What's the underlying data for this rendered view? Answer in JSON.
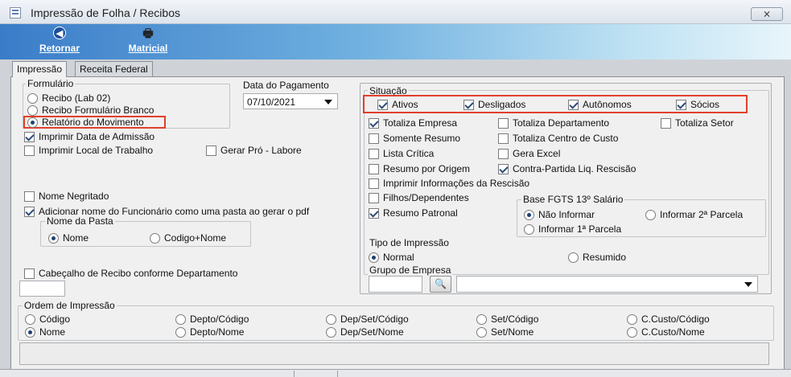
{
  "window": {
    "title": "Impressão de Folha / Recibos",
    "close_label": "⨯"
  },
  "toolbar": {
    "retornar": {
      "label": "Retornar",
      "icon": "back-arrow-icon"
    },
    "matricial": {
      "label": "Matricial",
      "icon": "printer-icon"
    }
  },
  "tabs": [
    {
      "label": "Impressão",
      "active": true
    },
    {
      "label": "Receita Federal",
      "active": false
    }
  ],
  "formulario": {
    "legend": "Formulário",
    "options": [
      {
        "label": "Recibo (Lab 02)",
        "selected": false
      },
      {
        "label": "Recibo Formulário Branco",
        "selected": false
      },
      {
        "label": "Relatório do Movimento",
        "selected": true
      }
    ]
  },
  "data_pagamento": {
    "label": "Data do Pagamento",
    "value": "07/10/2021"
  },
  "left_checks": {
    "imprimir_data_admissao": {
      "label": "Imprimir Data de Admissão",
      "checked": true
    },
    "imprimir_local_trabalho": {
      "label": "Imprimir Local de Trabalho",
      "checked": false
    },
    "gerar_pro_labore": {
      "label": "Gerar Pró - Labore",
      "checked": false
    },
    "nome_negritado": {
      "label": "Nome Negritado",
      "checked": false
    },
    "adicionar_nome": {
      "label": "Adicionar nome do Funcionário como uma pasta ao gerar o pdf",
      "checked": true
    },
    "cabecalho": {
      "label": "Cabeçalho de Recibo conforme Departamento",
      "checked": false
    }
  },
  "nome_pasta": {
    "legend": "Nome da Pasta",
    "options": [
      {
        "label": "Nome",
        "selected": true
      },
      {
        "label": "Codigo+Nome",
        "selected": false
      }
    ]
  },
  "situacao": {
    "legend": "Situação",
    "items": [
      {
        "label": "Ativos",
        "checked": true
      },
      {
        "label": "Desligados",
        "checked": true
      },
      {
        "label": "Autônomos",
        "checked": true
      },
      {
        "label": "Sócios",
        "checked": true
      }
    ]
  },
  "right_checks": {
    "totaliza_empresa": {
      "label": "Totaliza Empresa",
      "checked": true
    },
    "totaliza_departamento": {
      "label": "Totaliza Departamento",
      "checked": false
    },
    "totaliza_setor": {
      "label": "Totaliza Setor",
      "checked": false
    },
    "somente_resumo": {
      "label": "Somente Resumo",
      "checked": false
    },
    "totaliza_centro_custo": {
      "label": "Totaliza Centro de Custo",
      "checked": false
    },
    "lista_critica": {
      "label": "Lista Crítica",
      "checked": false
    },
    "gera_excel": {
      "label": "Gera Excel",
      "checked": false
    },
    "resumo_origem": {
      "label": "Resumo por Origem",
      "checked": false
    },
    "contra_partida": {
      "label": "Contra-Partida Liq. Rescisão",
      "checked": true
    },
    "imprimir_info_rescisao": {
      "label": "Imprimir Informações da Rescisão",
      "checked": false
    },
    "filhos_dependentes": {
      "label": "Filhos/Dependentes",
      "checked": false
    },
    "resumo_patronal": {
      "label": "Resumo Patronal",
      "checked": true
    }
  },
  "base_fgts": {
    "legend": "Base FGTS 13º Salário",
    "options": [
      {
        "label": "Não Informar",
        "selected": true
      },
      {
        "label": "Informar 2ª Parcela",
        "selected": false
      },
      {
        "label": "Informar 1ª Parcela",
        "selected": false
      }
    ]
  },
  "tipo_impressao": {
    "legend": "Tipo de Impressão",
    "options": [
      {
        "label": "Normal",
        "selected": true
      },
      {
        "label": "Resumido",
        "selected": false
      }
    ]
  },
  "grupo_empresa": {
    "legend": "Grupo de Empresa",
    "code_value": "",
    "select_value": ""
  },
  "ordem_impressao": {
    "legend": "Ordem de Impressão",
    "options": [
      {
        "label": "Código",
        "selected": false
      },
      {
        "label": "Depto/Código",
        "selected": false
      },
      {
        "label": "Dep/Set/Código",
        "selected": false
      },
      {
        "label": "Set/Código",
        "selected": false
      },
      {
        "label": "C.Custo/Código",
        "selected": false
      },
      {
        "label": "Nome",
        "selected": true
      },
      {
        "label": "Depto/Nome",
        "selected": false
      },
      {
        "label": "Dep/Set/Nome",
        "selected": false
      },
      {
        "label": "Set/Nome",
        "selected": false
      },
      {
        "label": "C.Custo/Nome",
        "selected": false
      }
    ]
  },
  "colors": {
    "highlight_border": "#e0402a",
    "toolbar_start": "#3a7cc8",
    "toolbar_end": "#e8f5fb"
  }
}
